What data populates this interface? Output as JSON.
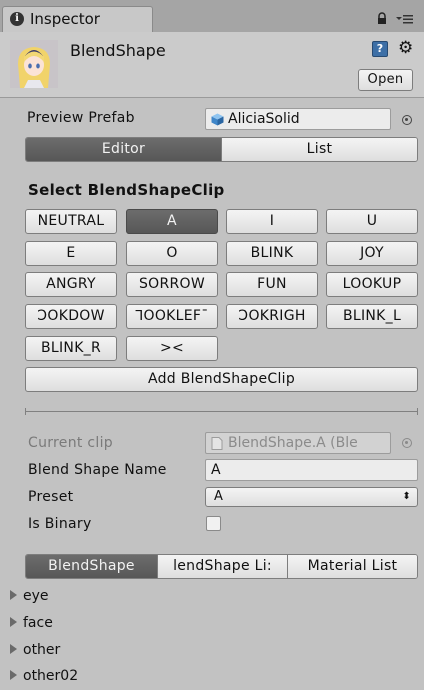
{
  "tab": {
    "title": "Inspector"
  },
  "header": {
    "object_name": "BlendShape",
    "open_label": "Open"
  },
  "preview": {
    "label": "Preview Prefab",
    "value": "AliciaSolid"
  },
  "mode_tabs": [
    {
      "label": "Editor",
      "selected": true
    },
    {
      "label": "List",
      "selected": false
    }
  ],
  "select": {
    "heading": "Select BlendShapeClip",
    "clips": [
      "NEUTRAL",
      "A",
      "I",
      "U",
      "E",
      "O",
      "BLINK",
      "JOY",
      "ANGRY",
      "SORROW",
      "FUN",
      "LOOKUP",
      "ƆOKDOW",
      "ꓶOOKLEFˉ",
      "ƆOKRIGH",
      "BLINK_L",
      "BLINK_R",
      "><"
    ],
    "selected_clip": "A",
    "add_label": "Add BlendShapeClip"
  },
  "clip": {
    "current_label": "Current clip",
    "current_value": "BlendShape.A (Ble",
    "name_label": "Blend Shape Name",
    "name_value": "A",
    "preset_label": "Preset",
    "preset_value": "A",
    "binary_label": "Is Binary",
    "binary_checked": false
  },
  "sub_tabs": [
    {
      "label": "BlendShape",
      "selected": true
    },
    {
      "label": "lendShape Li:",
      "selected": false
    },
    {
      "label": "Material List",
      "selected": false
    }
  ],
  "tree": [
    "eye",
    "face",
    "other",
    "other02"
  ],
  "colors": {
    "selected": "#5e5e5e",
    "background": "#c2c2c2",
    "field": "#ececec"
  }
}
